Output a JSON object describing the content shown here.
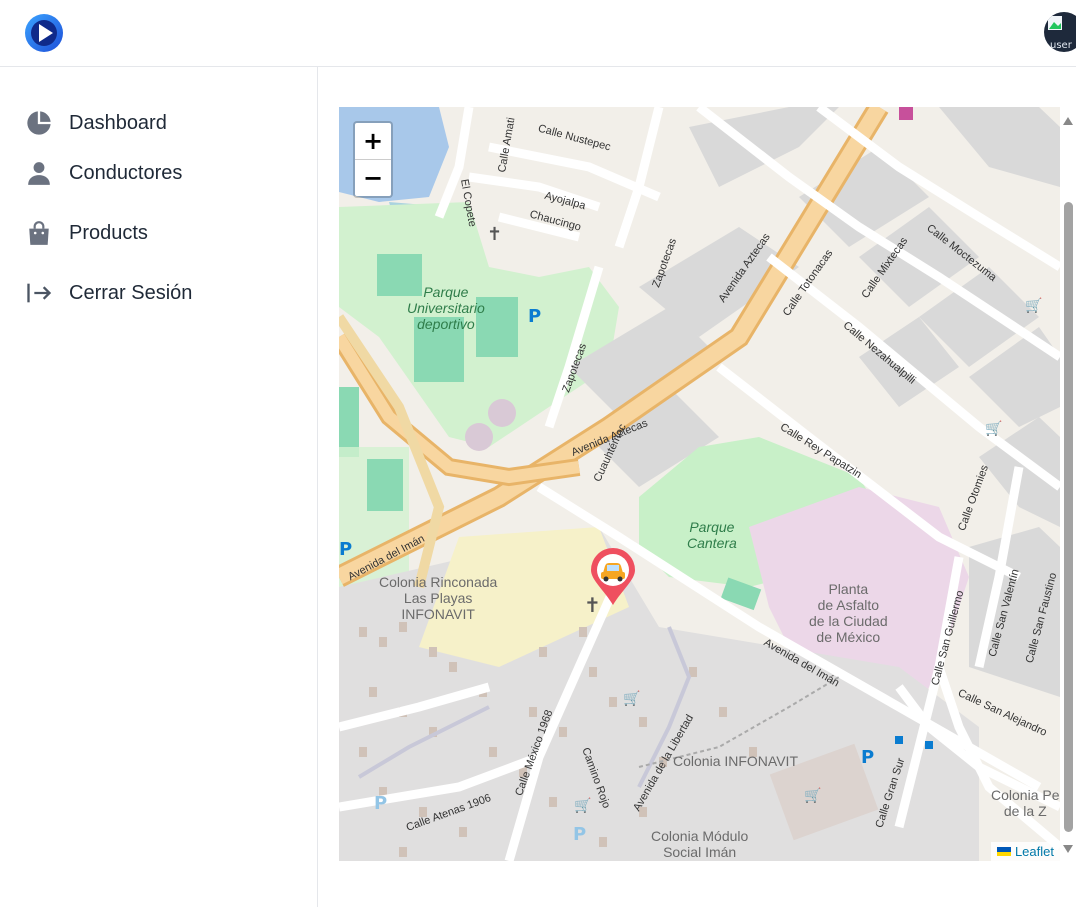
{
  "nav": {
    "items": [
      {
        "label": "Dashboard",
        "icon": "chart-pie-icon"
      },
      {
        "label": "Conductores",
        "icon": "user-icon"
      },
      {
        "label": "Products",
        "icon": "shopping-bag-icon"
      },
      {
        "label": "Cerrar Sesión",
        "icon": "logout-arrow-icon"
      }
    ]
  },
  "header": {
    "avatar_alt": "user"
  },
  "map": {
    "zoom_in": "+",
    "zoom_out": "−",
    "attribution": "Leaflet",
    "labels": {
      "parque_universitario": "Parque\nUniversitario\ndeportivo",
      "parque_cantera": "Parque\nCantera",
      "planta_asfalto": "Planta\nde Asfalto\nde la Ciudad\nde México",
      "colonia_rinconada": "Colonia Rinconada\nLas Playas\nINFONAVIT",
      "colonia_infonavit": "Colonia INFONAVIT",
      "colonia_modulo": "Colonia Módulo\nSocial Imán",
      "colonia_pe": "Colonia Pe\nde la Z",
      "avenida_aztecas": "Avenida Aztecas",
      "avenida_aztecas_2": "Avenida Aztecas",
      "avenida_iman": "Avenida del Imán",
      "avenida_iman_2": "Avenida del Imán",
      "calle_nustepec": "Calle Nustepec",
      "ayojalpa": "Ayojalpa",
      "chaucingo": "Chaucingo",
      "zapotecas": "Zapotecas",
      "zapotecas_2": "Zapotecas",
      "calle_rey_papatzin": "Calle Rey Papatzin",
      "calle_nezahualpilli": "Calle Nezahualpilli",
      "calle_totonacas": "Calle Totonacas",
      "calle_mixtecas": "Calle Mixtecas",
      "calle_moctezuma": "Calle Moctezuma",
      "calle_otomies": "Calle Otomies",
      "calle_san_guillermo": "Calle San Guillermo",
      "calle_san_valentin": "Calle San Valentín",
      "calle_san_faustino": "Calle San Faustino",
      "calle_san_alejandro": "Calle San Alejandro",
      "calle_mexico_1968": "Calle México 1968",
      "camino_rojo": "Camino Rojo",
      "avenida_libertad": "Avenida de la Libertad",
      "calle_atenas": "Calle Atenas 1906",
      "calle_gran_sur": "Calle Gran Sur",
      "cuauhtemoc": "Cuauhtémoc",
      "el_copete": "El Copete",
      "calle_amati": "Calle Amati"
    }
  },
  "colors": {
    "accent": "#1d4ed8",
    "marker": "#ef4f5f",
    "road_primary": "#f7c77c",
    "park": "#c8f0c8",
    "industrial": "#ecd7e8"
  }
}
